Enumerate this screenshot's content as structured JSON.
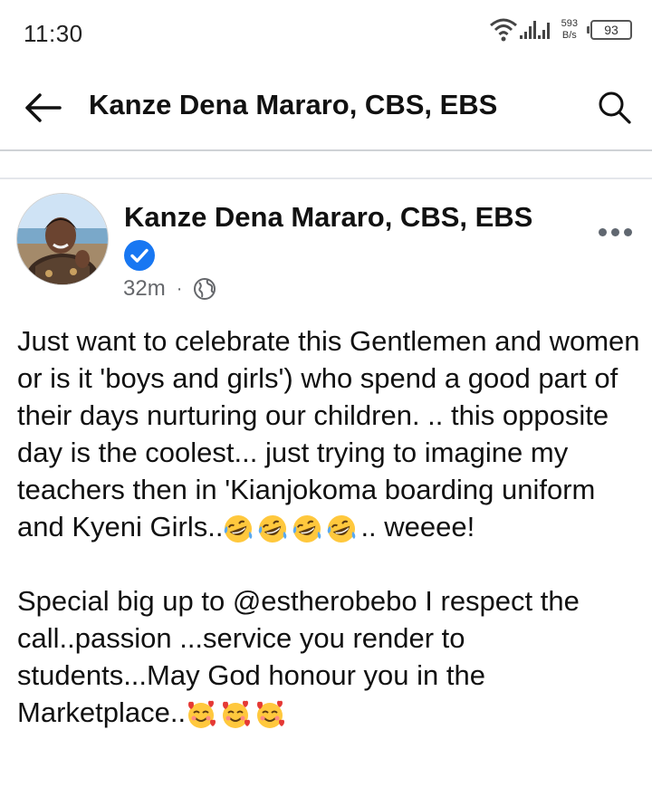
{
  "status": {
    "time": "11:30",
    "net_speed_value": "593",
    "net_speed_unit": "B/s",
    "battery": "93"
  },
  "appbar": {
    "title": "Kanze Dena Mararo, CBS, EBS"
  },
  "post": {
    "author": "Kanze Dena Mararo, CBS, EBS",
    "time_ago": "32m",
    "audience_icon": "globe-icon",
    "verified_icon": "verified-badge-icon",
    "text_line1": "Just want to celebrate  this Gentlemen and women or is it 'boys and girls') who spend  a good part of their days nurturing our children. .. this opposite  day is the coolest... just trying to imagine my teachers then in 'Kianjokoma boarding uniform and Kyeni Girls..",
    "text_line1_tail": ".. weeee!",
    "laugh_emoji": "rolling-laughing-emoji",
    "laugh_emoji_count": 4,
    "text_para2": "Special big up to @estherobebo I respect the call..passion ...service you render to students...May God honour you in the Marketplace..",
    "love_emoji": "smiling-face-with-hearts-emoji",
    "love_emoji_count": 3
  },
  "colors": {
    "verified_blue": "#1877f2",
    "emoji_yellow": "#ffc83d",
    "divider": "#cfd2d6",
    "meta_gray": "#65676b"
  }
}
